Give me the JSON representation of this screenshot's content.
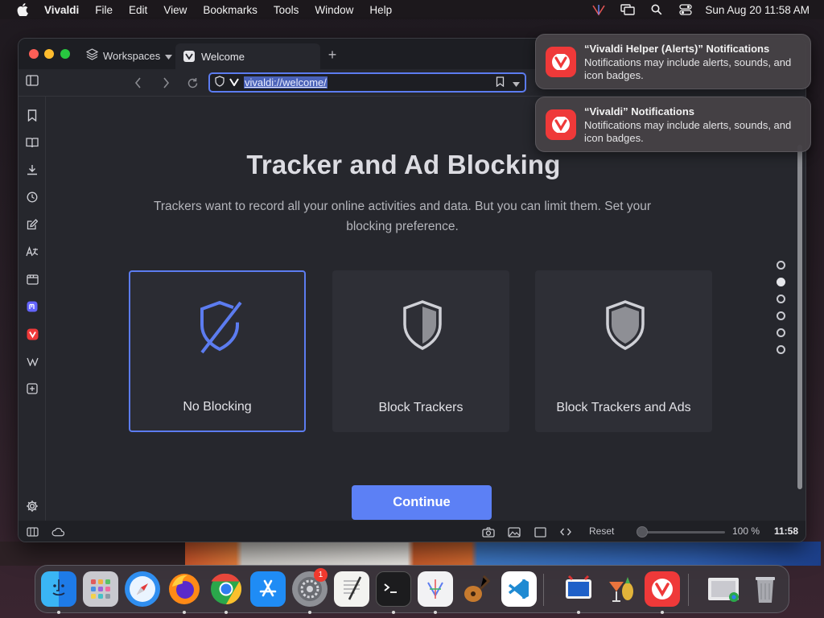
{
  "menubar": {
    "app_name": "Vivaldi",
    "items": [
      "File",
      "Edit",
      "View",
      "Bookmarks",
      "Tools",
      "Window",
      "Help"
    ],
    "clock": "Sun Aug 20  11:58 AM"
  },
  "browser": {
    "workspaces_label": "Workspaces",
    "tab_title": "Welcome",
    "url": "vivaldi://welcome/",
    "statusbar": {
      "reset_label": "Reset",
      "zoom_level": "100 %",
      "time": "11:58"
    }
  },
  "page": {
    "heading": "Tracker and Ad Blocking",
    "subtext": "Trackers want to record all your online activities and data. But you can limit them. Set your blocking preference.",
    "options": [
      {
        "label": "No Blocking",
        "selected": true
      },
      {
        "label": "Block Trackers",
        "selected": false
      },
      {
        "label": "Block Trackers and Ads",
        "selected": false
      }
    ],
    "continue_label": "Continue",
    "steps_total": 6,
    "steps_active": 2
  },
  "notifications": [
    {
      "title": "“Vivaldi Helper (Alerts)” Notifications",
      "body": "Notifications may include alerts, sounds, and icon badges."
    },
    {
      "title": "“Vivaldi” Notifications",
      "body": "Notifications may include alerts, sounds, and icon badges."
    }
  ],
  "dock": {
    "settings_badge": "1",
    "apps": [
      "Finder",
      "Launchpad",
      "Safari",
      "Firefox",
      "Chrome",
      "App Store",
      "System Settings",
      "TextEdit",
      "Terminal",
      "Vivaldi Dev",
      "GarageBand",
      "VS Code",
      "Parallels",
      "Cocktail",
      "Vivaldi",
      "Downloads",
      "Trash"
    ]
  },
  "colors": {
    "accent": "#5c7cf0",
    "continue_button": "#5c80f5",
    "vivaldi_red": "#ef3939",
    "window_bg": "#26272d"
  }
}
